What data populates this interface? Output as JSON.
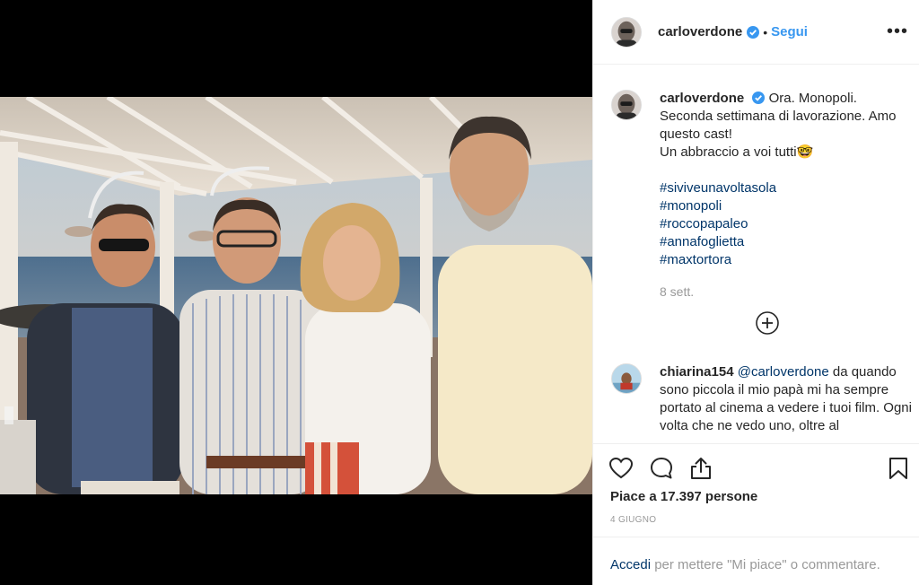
{
  "post": {
    "username": "carloverdone",
    "follow_label": "Segui",
    "dot": "•",
    "more_label": "•••"
  },
  "caption": {
    "username": "carloverdone",
    "lines": [
      "Ora. Monopoli.",
      "Seconda settimana di lavorazione. Amo questo cast!",
      "Un abbraccio a voi tutti🤓"
    ],
    "hashtags": [
      "#siviveunavoltasola",
      "#monopoli",
      "#roccopapaleo",
      "#annafoglietta",
      "#maxtortora"
    ],
    "time": "8 sett."
  },
  "comment": {
    "username": "chiarina154",
    "mention": "@carloverdone",
    "text": "da quando sono piccola il mio papà mi ha sempre portato al cinema a vedere i tuoi film. Ogni volta che ne vedo uno, oltre al"
  },
  "actions": {
    "likes": "Piace a 17.397 persone",
    "date": "4 GIUGNO"
  },
  "login": {
    "link": "Accedi",
    "text": " per mettere \"Mi piace\" o commentare."
  },
  "icons": {
    "verified": "verified-badge-icon",
    "more": "more-options-icon",
    "load_more": "plus-circle-icon",
    "like": "heart-icon",
    "comment": "speech-bubble-icon",
    "share": "share-icon",
    "save": "bookmark-icon"
  },
  "colors": {
    "accent": "#3897f0",
    "link": "#003569",
    "muted": "#999999",
    "text": "#262626",
    "border": "#efefef"
  }
}
